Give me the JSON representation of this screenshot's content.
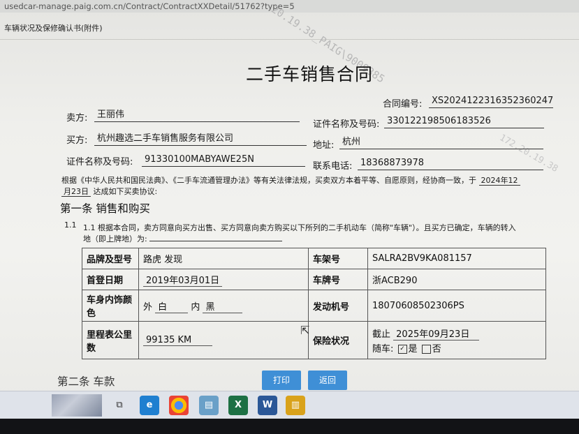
{
  "browser": {
    "url": "usedcar-manage.paig.com.cn/Contract/ContractXXDetail/51762?type=5"
  },
  "watermarks": {
    "center": "20.19.38_PAIG\\9009385",
    "right": "172.20.19.38"
  },
  "page": {
    "header": "车辆状况及保修确认书(附件)"
  },
  "contract": {
    "title": "二手车销售合同",
    "number_label": "合同编号:",
    "number": "XS2024122316352360247",
    "seller_label": "卖方:",
    "seller": "王丽伟",
    "seller_id_label": "证件名称及号码:",
    "seller_id": "330122198506183526",
    "buyer_label": "买方:",
    "buyer": "杭州趣选二手车销售服务有限公司",
    "address_label": "地址:",
    "address": "杭州",
    "buyer_id_label": "证件名称及号码:",
    "buyer_id": "91330100MABYAWE25N",
    "phone_label": "联系电话:",
    "phone": "18368873978",
    "intro_line1_a": "根据《中华人民共和国民法典》、《二手车流通管理办法》等有关法律法规，买卖双方本着平等、自愿原则，经协商一致，于",
    "intro_date_a": "2024年12",
    "intro_line2_date": "月23日",
    "intro_line2_b": "达成如下买卖协议:"
  },
  "clause1": {
    "heading": "第一条 销售和购买",
    "num": "1.1",
    "text_line1": "1.1 根据本合同，卖方同意向买方出售、买方同意向卖方购买以下所列的二手机动车（简称\"车辆\"）。且买方已确定，车辆的转入",
    "text_line2": "地（即上牌地）为:"
  },
  "vehicle": {
    "brand_label": "品牌及型号",
    "brand": "路虎 发现",
    "vin_label": "车架号",
    "vin": "SALRA2BV9KA081157",
    "first_reg_label": "首登日期",
    "first_reg": "2019年03月01日",
    "plate_label": "车牌号",
    "plate": "浙ACB290",
    "color_label": "车身内饰颜色",
    "color_out_label": "外",
    "color_out": "白",
    "color_in_label": "内",
    "color_in": "黑",
    "engine_label": "发动机号",
    "engine": "18070608502306PS",
    "mileage_label": "里程表公里数",
    "mileage": "99135 KM",
    "insurance_label": "保险状况",
    "insurance_until_label": "截止",
    "insurance_until": "2025年09月23日",
    "with_car_label": "随车:",
    "yes_label": "是",
    "no_label": "否",
    "yes_checked": true
  },
  "clause2": {
    "heading": "第二条 车款"
  },
  "buttons": {
    "print": "打印",
    "back": "返回"
  },
  "taskbar": {
    "apps": [
      "task-view",
      "edge",
      "chrome",
      "notepad",
      "excel",
      "word",
      "file-manager"
    ]
  },
  "colors": {
    "button": "#3f8fd6",
    "taskbar": "#dfe3ea"
  }
}
